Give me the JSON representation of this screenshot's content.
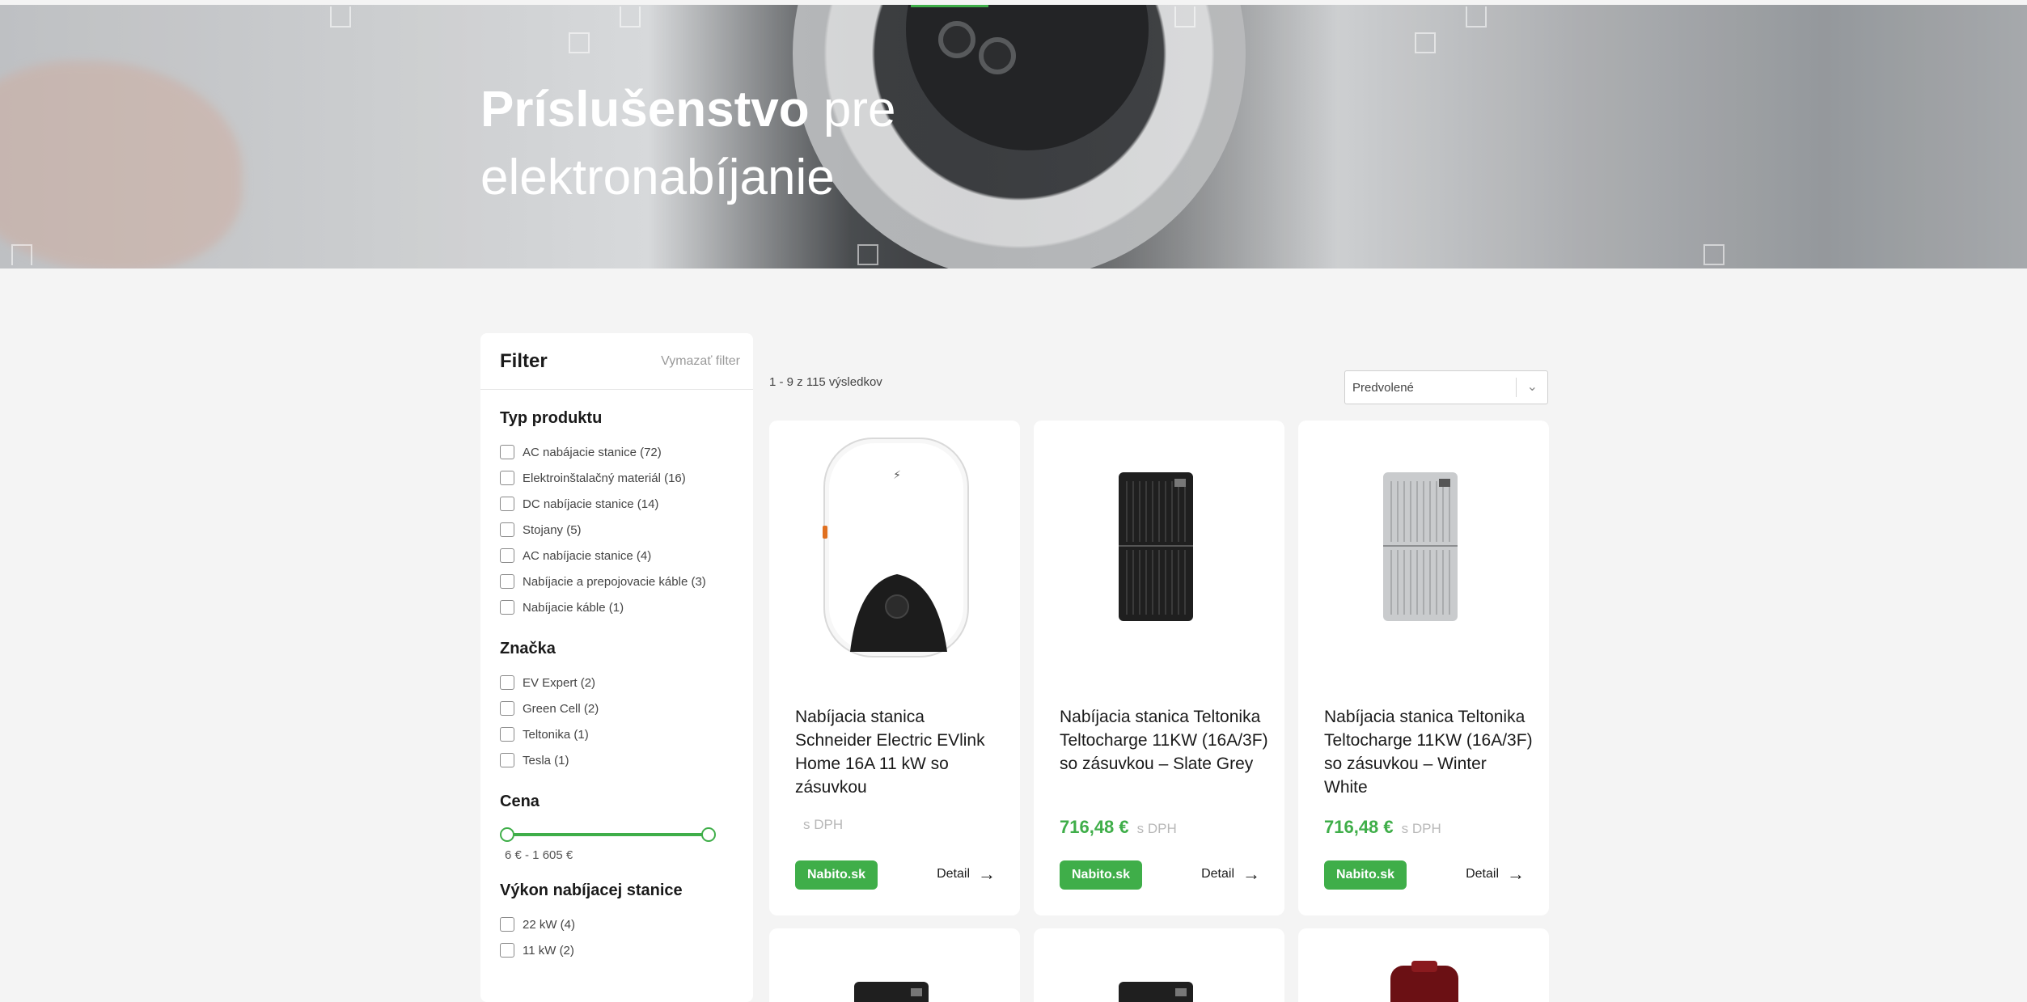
{
  "hero": {
    "title_bold": "Príslušenstvo",
    "title_rest_line1": " pre",
    "title_line2": "elektronabíjanie"
  },
  "filter": {
    "title": "Filter",
    "clear_label": "Vymazať filter",
    "sections": {
      "type": {
        "heading": "Typ produktu",
        "options": [
          "AC nabájacie stanice (72)",
          "Elektroinštalačný materiál (16)",
          "DC nabíjacie stanice (14)",
          "Stojany (5)",
          "AC nabíjacie stanice (4)",
          "Nabíjacie a prepojovacie káble (3)",
          "Nabíjacie káble (1)"
        ]
      },
      "brand": {
        "heading": "Značka",
        "options": [
          "EV Expert (2)",
          "Green Cell (2)",
          "Teltonika (1)",
          "Tesla (1)"
        ]
      },
      "price": {
        "heading": "Cena",
        "range": "6 € -  1 605 €"
      },
      "power": {
        "heading": "Výkon nabíjacej stanice",
        "options": [
          "22 kW (4)",
          "11 kW (2)"
        ]
      }
    }
  },
  "results": {
    "count": "1 - 9 z 115 výsledkov",
    "sort_value": "Predvolené",
    "products": [
      {
        "name": "Nabíjacia stanica Schneider Electric EVlink Home 16A 11 kW so zásuvkou",
        "price": "",
        "vat": "s DPH",
        "badge": "Nabito.sk",
        "detail": "Detail"
      },
      {
        "name": "Nabíjacia stanica Teltonika Teltocharge 11KW (16A/3F) so zásuvkou – Slate Grey",
        "price": "716,48 €",
        "vat": "s DPH",
        "badge": "Nabito.sk",
        "detail": "Detail"
      },
      {
        "name": "Nabíjacia stanica Teltonika Teltocharge 11KW (16A/3F) so zásuvkou – Winter White",
        "price": "716,48 €",
        "vat": "s DPH",
        "badge": "Nabito.sk",
        "detail": "Detail"
      }
    ]
  },
  "colors": {
    "accent": "#3fae49",
    "background": "#f4f4f4"
  }
}
